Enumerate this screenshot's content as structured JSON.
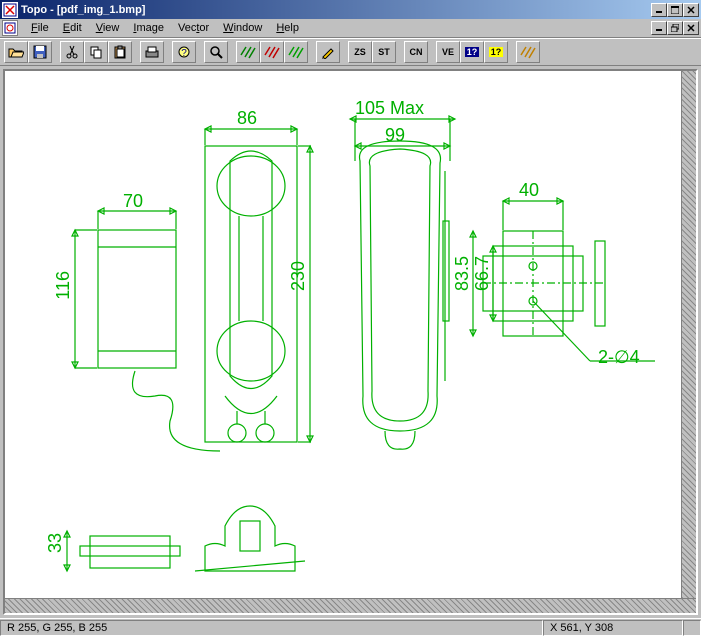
{
  "title": "Topo - [pdf_img_1.bmp]",
  "menu": {
    "file": "File",
    "edit": "Edit",
    "view": "View",
    "image": "Image",
    "vector": "Vector",
    "window": "Window",
    "help": "Help"
  },
  "toolbar": {
    "zs": "ZS",
    "st": "ST",
    "cn": "CN",
    "ve": "VE",
    "one": "1?",
    "oneq": "1?"
  },
  "dimensions": {
    "d70": "70",
    "d86": "86",
    "d105": "105 Max",
    "d99": "99",
    "d40": "40",
    "d116": "116",
    "d230": "230",
    "d835": "83.5",
    "d667": "66.7",
    "d33": "33",
    "d2phi4": "2-∅4"
  },
  "status": {
    "rgb": "R 255, G 255, B 255",
    "coords": "X 561, Y 308"
  }
}
